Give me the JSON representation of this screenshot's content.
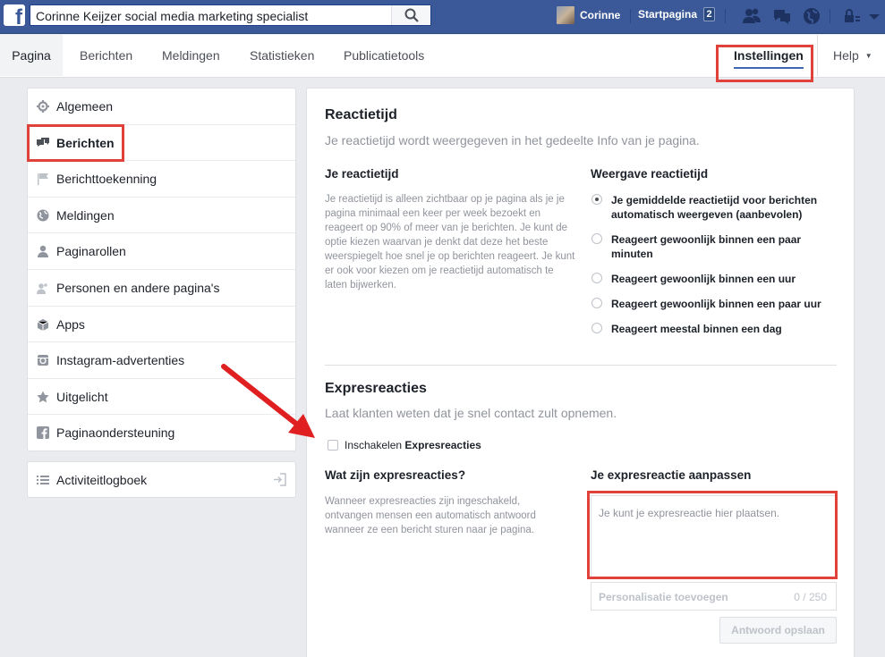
{
  "topbar": {
    "search_value": "Corinne Keijzer social media marketing specialist",
    "user_name": "Corinne",
    "home_label": "Startpagina",
    "home_count": "2"
  },
  "subnav": {
    "tabs": [
      "Pagina",
      "Berichten",
      "Meldingen",
      "Statistieken",
      "Publicatietools"
    ],
    "settings": "Instellingen",
    "help": "Help"
  },
  "sidebar": {
    "items": [
      {
        "label": "Algemeen",
        "icon": "gear-icon"
      },
      {
        "label": "Berichten",
        "icon": "chat-icon"
      },
      {
        "label": "Berichttoekenning",
        "icon": "flag-icon"
      },
      {
        "label": "Meldingen",
        "icon": "globe-icon"
      },
      {
        "label": "Paginarollen",
        "icon": "person-icon"
      },
      {
        "label": "Personen en andere pagina's",
        "icon": "person-add-icon"
      },
      {
        "label": "Apps",
        "icon": "box-icon"
      },
      {
        "label": "Instagram-advertenties",
        "icon": "instagram-icon"
      },
      {
        "label": "Uitgelicht",
        "icon": "star-icon"
      },
      {
        "label": "Paginaondersteuning",
        "icon": "facebook-icon"
      }
    ],
    "activity_log": "Activiteitlogboek"
  },
  "main": {
    "response_title": "Reactietijd",
    "response_sub": "Je reactietijd wordt weergegeven in het gedeelte Info van je pagina.",
    "your_response_title": "Je reactietijd",
    "your_response_desc": "Je reactietijd is alleen zichtbaar op je pagina als je je pagina minimaal een keer per week bezoekt en reageert op 90% of meer van je berichten. Je kunt de optie kiezen waarvan je denkt dat deze het beste weerspiegelt hoe snel je op berichten reageert. Je kunt er ook voor kiezen om je reactietijd automatisch te laten bijwerken.",
    "display_title": "Weergave reactietijd",
    "radio_options": [
      "Je gemiddelde reactietijd voor berichten automatisch weergeven (aanbevolen)",
      "Reageert gewoonlijk binnen een paar minuten",
      "Reageert gewoonlijk binnen een uur",
      "Reageert gewoonlijk binnen een paar uur",
      "Reageert meestal binnen een dag"
    ],
    "selected_option": 0,
    "express_title": "Expresreacties",
    "express_sub": "Laat klanten weten dat je snel contact zult opnemen.",
    "enable_prefix": "Inschakelen",
    "enable_bold": "Expresreacties",
    "what_title": "Wat zijn expresreacties?",
    "what_desc": "Wanneer expresreacties zijn ingeschakeld, ontvangen mensen een automatisch antwoord wanneer ze een bericht sturen naar je pagina.",
    "customize_title": "Je expresreactie aanpassen",
    "reply_placeholder": "Je kunt je expresreactie hier plaatsen.",
    "personalize_label": "Personalisatie toevoegen",
    "char_count": "0 / 250",
    "save_label": "Antwoord opslaan"
  },
  "colors": {
    "brand": "#3b5998",
    "highlight": "#e0413a",
    "arrow": "#e02020"
  }
}
